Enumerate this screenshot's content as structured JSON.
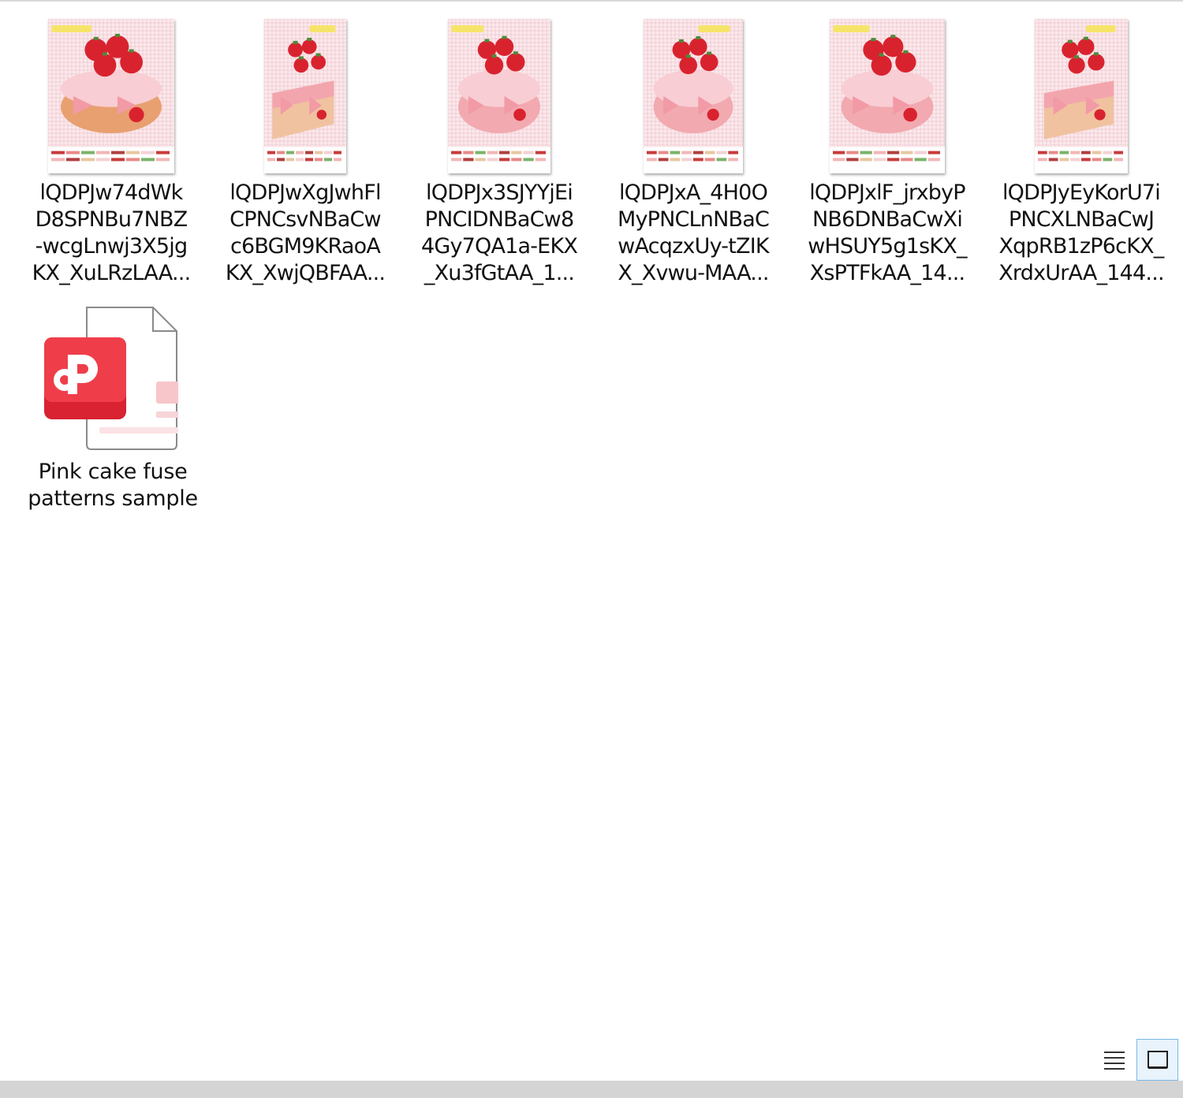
{
  "files": [
    {
      "name": "lQDPJw74dWk\nD8SPNBu7NBZ\n-wcgLnwj3X5jg\nKX_XuLRzLAA...",
      "icon": "image-thumbnail",
      "variant": 0
    },
    {
      "name": "lQDPJwXgJwhFl\nCPNCsvNBaCw\nc6BGM9KRaoA\nKX_XwjQBFAA...",
      "icon": "image-thumbnail",
      "variant": 1
    },
    {
      "name": "lQDPJx3SJYYjEi\nPNCIDNBaCw8\n4Gy7QA1a-EKX\n_Xu3fGtAA_1...",
      "icon": "image-thumbnail",
      "variant": 2
    },
    {
      "name": "lQDPJxA_4H0O\nMyPNCLnNBaC\nwAcqzxUy-tZIK\nX_Xvwu-MAA...",
      "icon": "image-thumbnail",
      "variant": 3
    },
    {
      "name": "lQDPJxlF_jrxbyP\nNB6DNBaCwXi\nwHSUY5g1sKX_\nXsPTFkAA_14...",
      "icon": "image-thumbnail",
      "variant": 4
    },
    {
      "name": "lQDPJyEyKorU7i\nPNCXLNBaCwJ\nXqpRB1zP6cKX_\nXrdxUrAA_144...",
      "icon": "image-thumbnail",
      "variant": 5
    },
    {
      "name": "Pink cake fuse\npatterns sample",
      "icon": "pdf-document-icon",
      "variant": 6
    }
  ],
  "colors": {
    "accent": "#78b8e8",
    "pdf_red": "#e8313f"
  },
  "view": {
    "details_icon": "details-view-icon",
    "tiles_icon": "large-icons-view-icon"
  }
}
